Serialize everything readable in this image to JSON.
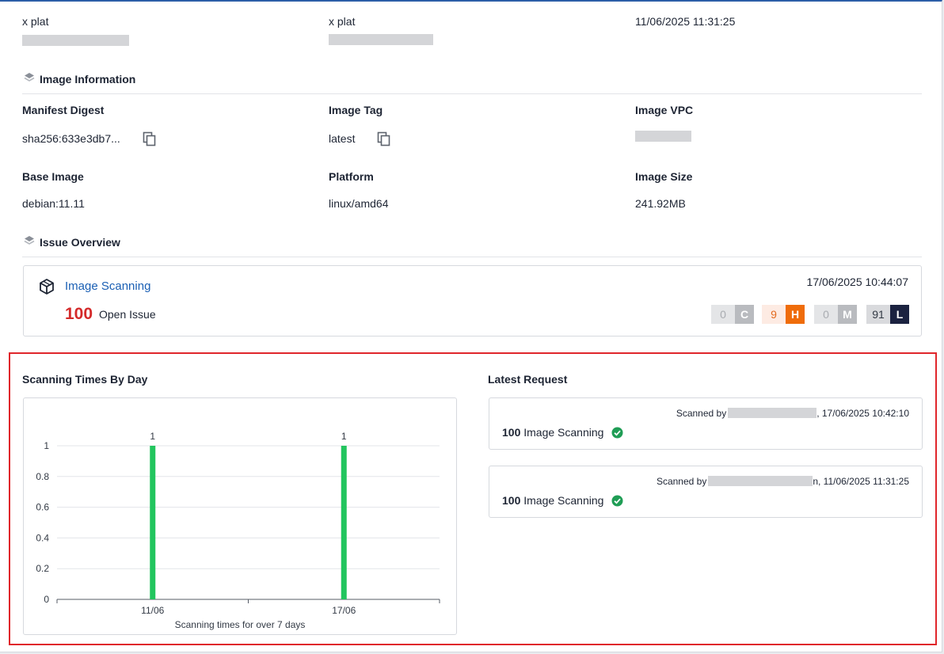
{
  "top_row": {
    "col1_value": "x plat",
    "col2_value": "x plat",
    "col3_value": "11/06/2025 11:31:25"
  },
  "image_info": {
    "section_title": "Image Information",
    "manifest_label": "Manifest Digest",
    "manifest_value": "sha256:633e3db7...",
    "tag_label": "Image Tag",
    "tag_value": "latest",
    "vpc_label": "Image VPC",
    "base_label": "Base Image",
    "base_value": "debian:11.11",
    "platform_label": "Platform",
    "platform_value": "linux/amd64",
    "size_label": "Image Size",
    "size_value": "241.92MB"
  },
  "issue_overview": {
    "section_title": "Issue Overview",
    "card_title": "Image Scanning",
    "count": "100",
    "count_label": "Open Issue",
    "timestamp": "17/06/2025 10:44:07",
    "severities": [
      {
        "count": "0",
        "letter": "C",
        "count_bg": "#e4e5e7",
        "count_color": "#a9acb1",
        "letter_bg": "#b9bbbf"
      },
      {
        "count": "9",
        "letter": "H",
        "count_bg": "#fdebe3",
        "count_color": "#e36a1e",
        "letter_bg": "#ef6c0a"
      },
      {
        "count": "0",
        "letter": "M",
        "count_bg": "#e4e5e7",
        "count_color": "#a9acb1",
        "letter_bg": "#b9bbbf"
      },
      {
        "count": "91",
        "letter": "L",
        "count_bg": "#d9dadd",
        "count_color": "#333a45",
        "letter_bg": "#1b2240"
      }
    ]
  },
  "scanning_chart": {
    "title": "Scanning Times By Day",
    "caption": "Scanning times for over 7 days"
  },
  "chart_data": {
    "type": "bar",
    "categories": [
      "11/06",
      "17/06"
    ],
    "values": [
      1,
      1
    ],
    "ylim": [
      0,
      1
    ],
    "yticks": [
      "0",
      "0.2",
      "0.4",
      "0.6",
      "0.8",
      "1"
    ],
    "data_labels": [
      "1",
      "1"
    ],
    "xlabel": "Scanning times for over 7 days",
    "ylabel": "",
    "grid": true,
    "bar_color": "#22c55e"
  },
  "latest_request": {
    "title": "Latest Request",
    "requests": [
      {
        "scanned_by_label": "Scanned by",
        "time_suffix": ", 17/06/2025 10:42:10",
        "count": "100",
        "label": "Image Scanning"
      },
      {
        "scanned_by_label": "Scanned by",
        "time_suffix": "n, 11/06/2025 11:31:25",
        "count": "100",
        "label": "Image Scanning"
      }
    ]
  }
}
